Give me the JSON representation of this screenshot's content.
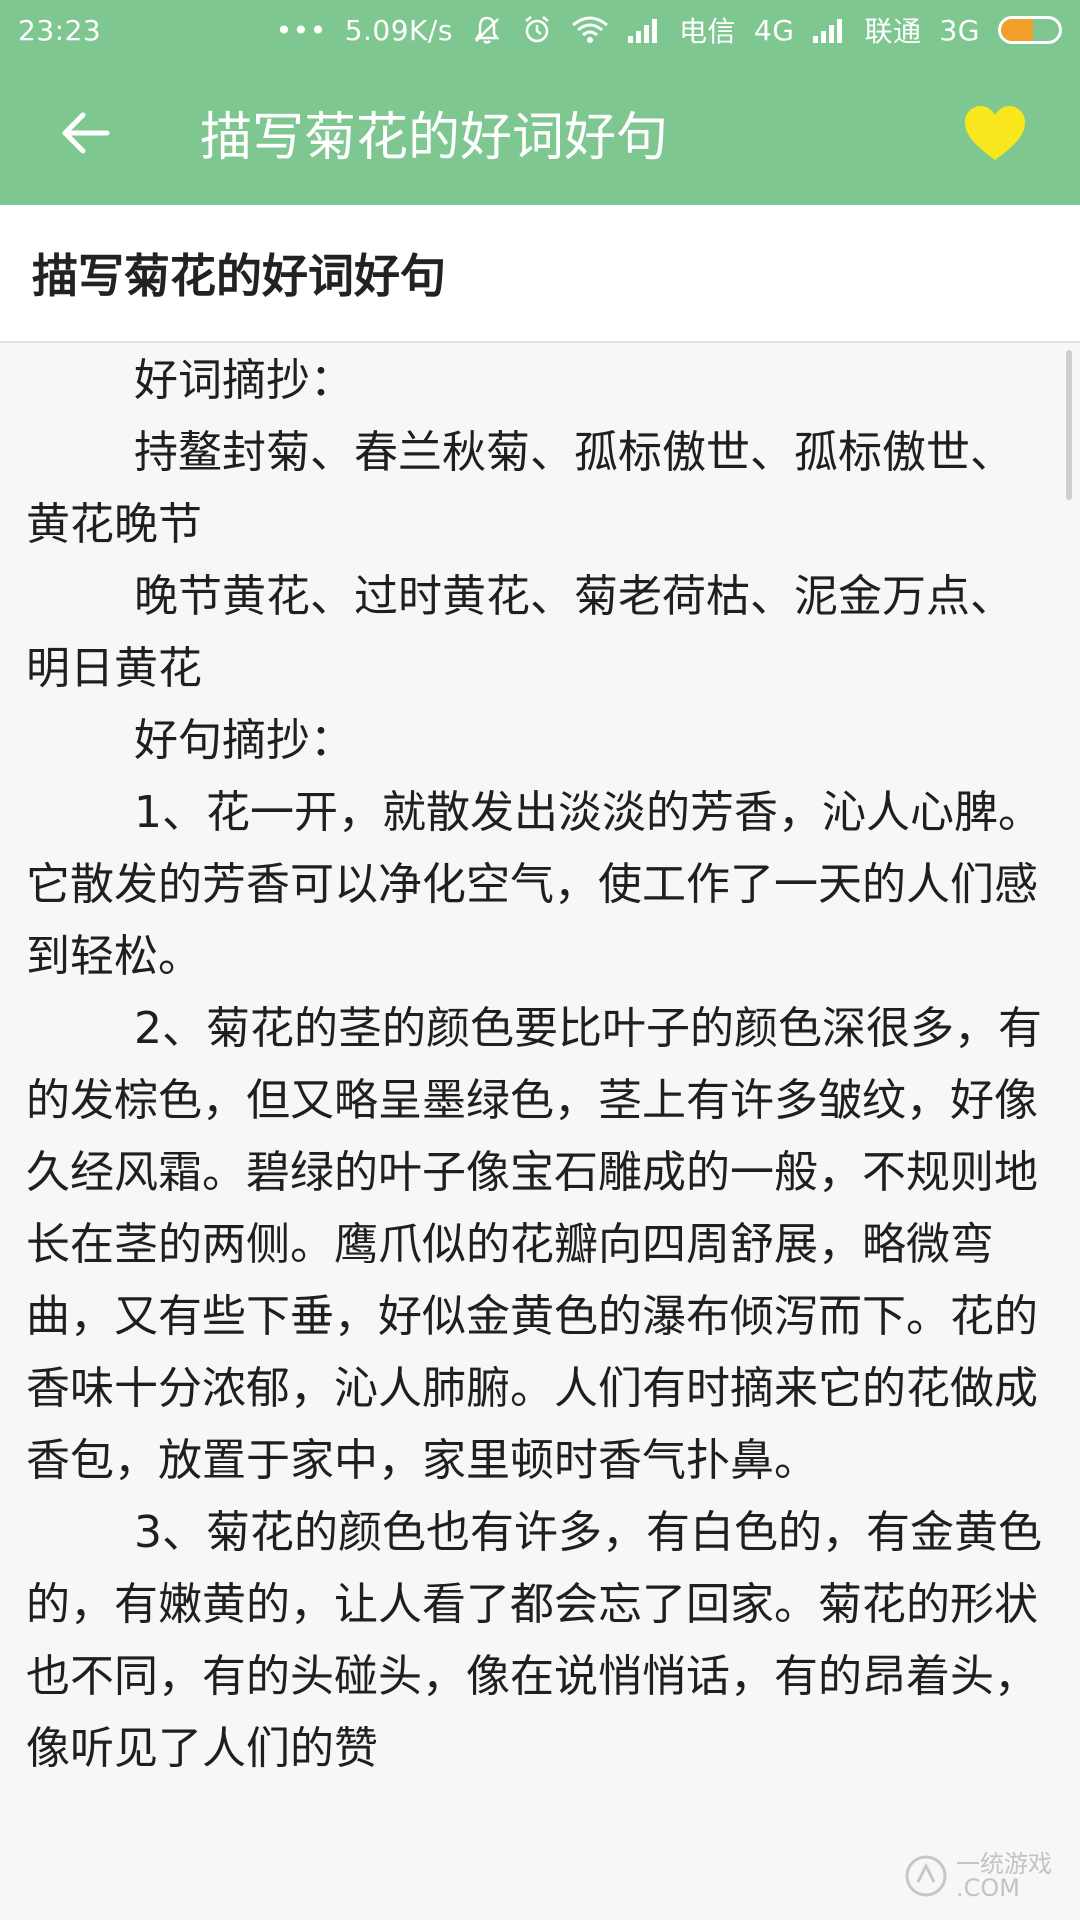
{
  "status_bar": {
    "time": "23:23",
    "dots": "•••",
    "speed": "5.09K/s",
    "carrier1": "电信",
    "net1": "4G",
    "carrier2": "联通",
    "net2": "3G",
    "battery_level": 0.55,
    "battery_color": "#f29f2b"
  },
  "app_bar": {
    "title": "描写菊花的好词好句",
    "back_icon": "arrow-left-icon",
    "favorite_icon": "heart-icon",
    "bg_color": "#7fc791",
    "heart_color": "#f8e71c"
  },
  "article": {
    "title": "描写菊花的好词好句",
    "paragraphs": [
      "好词摘抄：",
      "持鳌封菊、春兰秋菊、孤标傲世、孤标傲世、黄花晚节",
      "晚节黄花、过时黄花、菊老荷枯、泥金万点、明日黄花",
      "好句摘抄：",
      "1、花一开，就散发出淡淡的芳香，沁人心脾。它散发的芳香可以净化空气，使工作了一天的人们感到轻松。",
      "2、菊花的茎的颜色要比叶子的颜色深很多，有的发棕色，但又略呈墨绿色，茎上有许多皱纹，好像久经风霜。碧绿的叶子像宝石雕成的一般，不规则地长在茎的两侧。鹰爪似的花瓣向四周舒展，略微弯曲，又有些下垂，好似金黄色的瀑布倾泻而下。花的香味十分浓郁，沁人肺腑。人们有时摘来它的花做成香包，放置于家中，家里顿时香气扑鼻。",
      "3、菊花的颜色也有许多，有白色的，有金黄色的，有嫩黄的，让人看了都会忘了回家。菊花的形状也不同，有的头碰头，像在说悄悄话，有的昂着头，像听见了人们的赞"
    ]
  },
  "watermark": {
    "text": "一统游戏",
    "sub": ".COM"
  }
}
